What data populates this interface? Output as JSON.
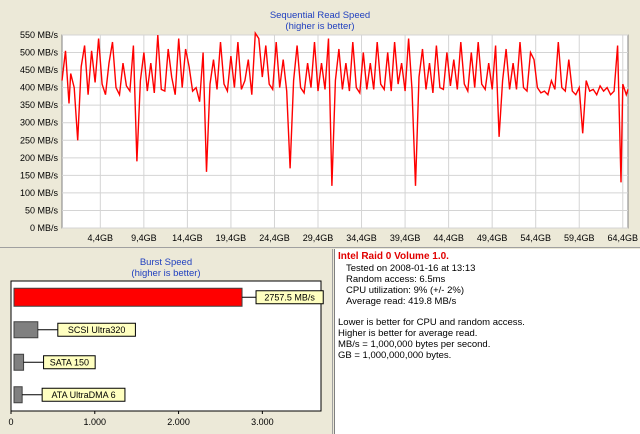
{
  "sequential": {
    "title": "Sequential Read Speed",
    "subtitle": "(higher is better)",
    "y_tick_labels": [
      "0 MB/s",
      "50 MB/s",
      "100 MB/s",
      "150 MB/s",
      "200 MB/s",
      "250 MB/s",
      "300 MB/s",
      "350 MB/s",
      "400 MB/s",
      "450 MB/s",
      "500 MB/s",
      "550 MB/s"
    ],
    "x_tick_labels": [
      "4,4GB",
      "9,4GB",
      "14,4GB",
      "19,4GB",
      "24,4GB",
      "29,4GB",
      "34,4GB",
      "39,4GB",
      "44,4GB",
      "49,4GB",
      "54,4GB",
      "59,4GB",
      "64,4GB"
    ],
    "line_color": "#ff0000"
  },
  "burst": {
    "title": "Burst Speed",
    "subtitle": "(higher is better)",
    "x_tick_labels": [
      "0",
      "1.000",
      "2.000",
      "3.000"
    ],
    "bars": [
      {
        "label": "2757.5 MB/s",
        "value": 2757.5,
        "color": "#ff0000"
      },
      {
        "label": "SCSI Ultra320",
        "value": 320,
        "color": "#808080"
      },
      {
        "label": "SATA 150",
        "value": 150,
        "color": "#808080"
      },
      {
        "label": "ATA UltraDMA 6",
        "value": 133,
        "color": "#808080"
      }
    ]
  },
  "info": {
    "title": "Intel Raid 0 Volume 1.0.",
    "tested_on": "Tested on 2008-01-16 at 13:13",
    "random_access": "Random access: 6.5ms",
    "cpu_utilization": "CPU utilization: 9% (+/- 2%)",
    "average_read": "Average read: 419.8 MB/s",
    "note_1": "Lower is better for CPU and random access.",
    "note_2": "Higher is better for average read.",
    "note_3": "MB/s = 1,000,000 bytes per second.",
    "note_4": "GB = 1,000,000,000 bytes."
  },
  "chart_data": [
    {
      "type": "line",
      "title": "Sequential Read Speed",
      "subtitle": "(higher is better)",
      "xlabel": "",
      "ylabel": "",
      "xlim": [
        0,
        65
      ],
      "ylim": [
        0,
        550
      ],
      "x_unit": "GB",
      "y_unit": "MB/s",
      "grid": true,
      "series": [
        {
          "values": [
            [
              0.0,
              420
            ],
            [
              0.4,
              505
            ],
            [
              0.8,
              355
            ],
            [
              1.0,
              440
            ],
            [
              1.4,
              400
            ],
            [
              1.8,
              250
            ],
            [
              2.2,
              460
            ],
            [
              2.6,
              520
            ],
            [
              3.0,
              380
            ],
            [
              3.4,
              505
            ],
            [
              3.8,
              415
            ],
            [
              4.2,
              540
            ],
            [
              4.6,
              410
            ],
            [
              5.0,
              380
            ],
            [
              5.4,
              470
            ],
            [
              5.8,
              530
            ],
            [
              6.2,
              400
            ],
            [
              6.6,
              380
            ],
            [
              7.0,
              470
            ],
            [
              7.4,
              405
            ],
            [
              7.8,
              390
            ],
            [
              8.2,
              520
            ],
            [
              8.6,
              190
            ],
            [
              9.0,
              420
            ],
            [
              9.4,
              500
            ],
            [
              9.8,
              390
            ],
            [
              10.2,
              470
            ],
            [
              10.6,
              385
            ],
            [
              11.0,
              550
            ],
            [
              11.4,
              395
            ],
            [
              11.8,
              390
            ],
            [
              12.2,
              510
            ],
            [
              12.6,
              430
            ],
            [
              13.0,
              380
            ],
            [
              13.4,
              540
            ],
            [
              13.8,
              400
            ],
            [
              14.2,
              510
            ],
            [
              14.6,
              460
            ],
            [
              15.0,
              390
            ],
            [
              15.4,
              400
            ],
            [
              15.8,
              360
            ],
            [
              16.2,
              500
            ],
            [
              16.6,
              160
            ],
            [
              17.0,
              410
            ],
            [
              17.4,
              480
            ],
            [
              17.8,
              395
            ],
            [
              18.2,
              530
            ],
            [
              18.6,
              410
            ],
            [
              19.0,
              390
            ],
            [
              19.4,
              490
            ],
            [
              19.8,
              400
            ],
            [
              20.2,
              530
            ],
            [
              20.6,
              395
            ],
            [
              21.0,
              420
            ],
            [
              21.4,
              480
            ],
            [
              21.8,
              380
            ],
            [
              22.2,
              555
            ],
            [
              22.6,
              540
            ],
            [
              23.0,
              430
            ],
            [
              23.4,
              520
            ],
            [
              23.8,
              410
            ],
            [
              24.2,
              395
            ],
            [
              24.6,
              530
            ],
            [
              25.0,
              400
            ],
            [
              25.4,
              480
            ],
            [
              25.8,
              390
            ],
            [
              26.2,
              170
            ],
            [
              26.6,
              420
            ],
            [
              27.0,
              520
            ],
            [
              27.4,
              400
            ],
            [
              27.8,
              385
            ],
            [
              28.2,
              470
            ],
            [
              28.6,
              400
            ],
            [
              29.0,
              530
            ],
            [
              29.4,
              390
            ],
            [
              29.8,
              470
            ],
            [
              30.2,
              395
            ],
            [
              30.6,
              540
            ],
            [
              31.0,
              120
            ],
            [
              31.4,
              420
            ],
            [
              31.8,
              510
            ],
            [
              32.2,
              395
            ],
            [
              32.6,
              470
            ],
            [
              33.0,
              390
            ],
            [
              33.4,
              530
            ],
            [
              33.8,
              400
            ],
            [
              34.2,
              385
            ],
            [
              34.6,
              500
            ],
            [
              35.0,
              395
            ],
            [
              35.4,
              470
            ],
            [
              35.8,
              395
            ],
            [
              36.2,
              530
            ],
            [
              36.6,
              410
            ],
            [
              37.0,
              395
            ],
            [
              37.4,
              500
            ],
            [
              37.8,
              390
            ],
            [
              38.2,
              530
            ],
            [
              38.6,
              410
            ],
            [
              39.0,
              470
            ],
            [
              39.4,
              390
            ],
            [
              39.8,
              540
            ],
            [
              40.2,
              395
            ],
            [
              40.6,
              120
            ],
            [
              41.0,
              430
            ],
            [
              41.4,
              510
            ],
            [
              41.8,
              395
            ],
            [
              42.2,
              470
            ],
            [
              42.6,
              385
            ],
            [
              43.0,
              520
            ],
            [
              43.4,
              400
            ],
            [
              43.8,
              395
            ],
            [
              44.2,
              500
            ],
            [
              44.6,
              405
            ],
            [
              45.0,
              480
            ],
            [
              45.4,
              395
            ],
            [
              45.8,
              530
            ],
            [
              46.2,
              410
            ],
            [
              46.6,
              390
            ],
            [
              47.0,
              500
            ],
            [
              47.4,
              400
            ],
            [
              47.8,
              530
            ],
            [
              48.2,
              410
            ],
            [
              48.6,
              395
            ],
            [
              49.0,
              470
            ],
            [
              49.4,
              395
            ],
            [
              49.8,
              520
            ],
            [
              50.2,
              260
            ],
            [
              50.6,
              420
            ],
            [
              51.0,
              510
            ],
            [
              51.4,
              395
            ],
            [
              51.8,
              470
            ],
            [
              52.2,
              395
            ],
            [
              52.6,
              530
            ],
            [
              53.0,
              400
            ],
            [
              53.4,
              390
            ],
            [
              53.8,
              500
            ],
            [
              54.2,
              480
            ],
            [
              54.6,
              400
            ],
            [
              55.0,
              385
            ],
            [
              55.4,
              390
            ],
            [
              55.8,
              380
            ],
            [
              56.2,
              420
            ],
            [
              56.6,
              395
            ],
            [
              57.0,
              530
            ],
            [
              57.4,
              400
            ],
            [
              57.8,
              390
            ],
            [
              58.2,
              480
            ],
            [
              58.6,
              390
            ],
            [
              59.0,
              380
            ],
            [
              59.4,
              400
            ],
            [
              59.8,
              270
            ],
            [
              60.2,
              420
            ],
            [
              60.6,
              390
            ],
            [
              61.0,
              395
            ],
            [
              61.4,
              380
            ],
            [
              61.8,
              405
            ],
            [
              62.2,
              390
            ],
            [
              62.6,
              400
            ],
            [
              63.0,
              380
            ],
            [
              63.4,
              390
            ],
            [
              63.8,
              520
            ],
            [
              64.2,
              130
            ],
            [
              64.4,
              410
            ],
            [
              64.8,
              380
            ],
            [
              65.0,
              395
            ]
          ]
        }
      ]
    },
    {
      "type": "bar",
      "orientation": "horizontal",
      "title": "Burst Speed",
      "subtitle": "(higher is better)",
      "categories": [
        "2757.5 MB/s",
        "SCSI Ultra320",
        "SATA 150",
        "ATA UltraDMA 6"
      ],
      "values": [
        2757.5,
        320,
        150,
        133
      ],
      "xlim": [
        0,
        3700
      ],
      "x_ticks": [
        "0",
        "1.000",
        "2.000",
        "3.000"
      ]
    }
  ]
}
